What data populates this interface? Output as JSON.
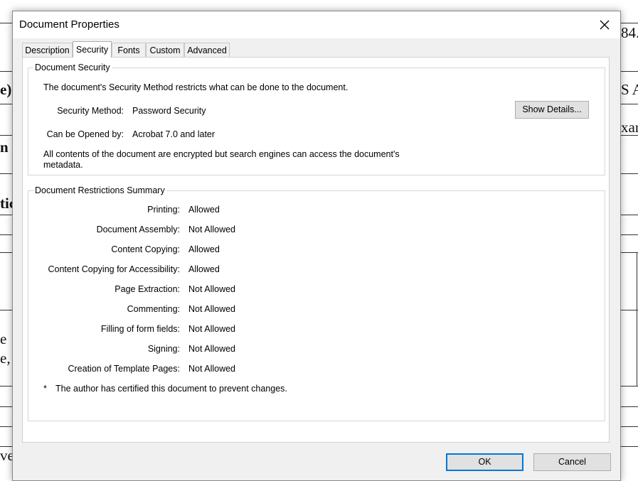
{
  "background": {
    "fragments": [
      "84.",
      "e)",
      "S A",
      "xan",
      "n F",
      "tic",
      "e",
      "e,",
      "ve"
    ]
  },
  "dialog": {
    "title": "Document Properties",
    "tabs": [
      "Description",
      "Security",
      "Fonts",
      "Custom",
      "Advanced"
    ],
    "active_tab": "Security",
    "security_group": {
      "title": "Document Security",
      "intro": "The document's Security Method restricts what can be done to the document.",
      "method_label": "Security Method:",
      "method_value": "Password Security",
      "opened_label": "Can be Opened by:",
      "opened_value": "Acrobat 7.0 and later",
      "note_line1": "All contents of the document are encrypted but search engines can access the document's",
      "note_line2": "metadata.",
      "show_details": "Show Details..."
    },
    "restrictions_group": {
      "title": "Document Restrictions Summary",
      "rows": [
        {
          "label": "Printing:",
          "value": "Allowed"
        },
        {
          "label": "Document Assembly:",
          "value": "Not Allowed"
        },
        {
          "label": "Content Copying:",
          "value": "Allowed"
        },
        {
          "label": "Content Copying for Accessibility:",
          "value": "Allowed"
        },
        {
          "label": "Page Extraction:",
          "value": "Not Allowed"
        },
        {
          "label": "Commenting:",
          "value": "Not Allowed"
        },
        {
          "label": "Filling of form fields:",
          "value": "Not Allowed"
        },
        {
          "label": "Signing:",
          "value": "Not Allowed"
        },
        {
          "label": "Creation of Template Pages:",
          "value": "Not Allowed"
        }
      ],
      "footnote_mark": "*",
      "footnote": "The author has certified this document to prevent changes."
    },
    "ok_label": "OK",
    "cancel_label": "Cancel"
  },
  "colors": {
    "dialog_bg": "#f0f0f0",
    "default_button_border": "#0078d7"
  }
}
